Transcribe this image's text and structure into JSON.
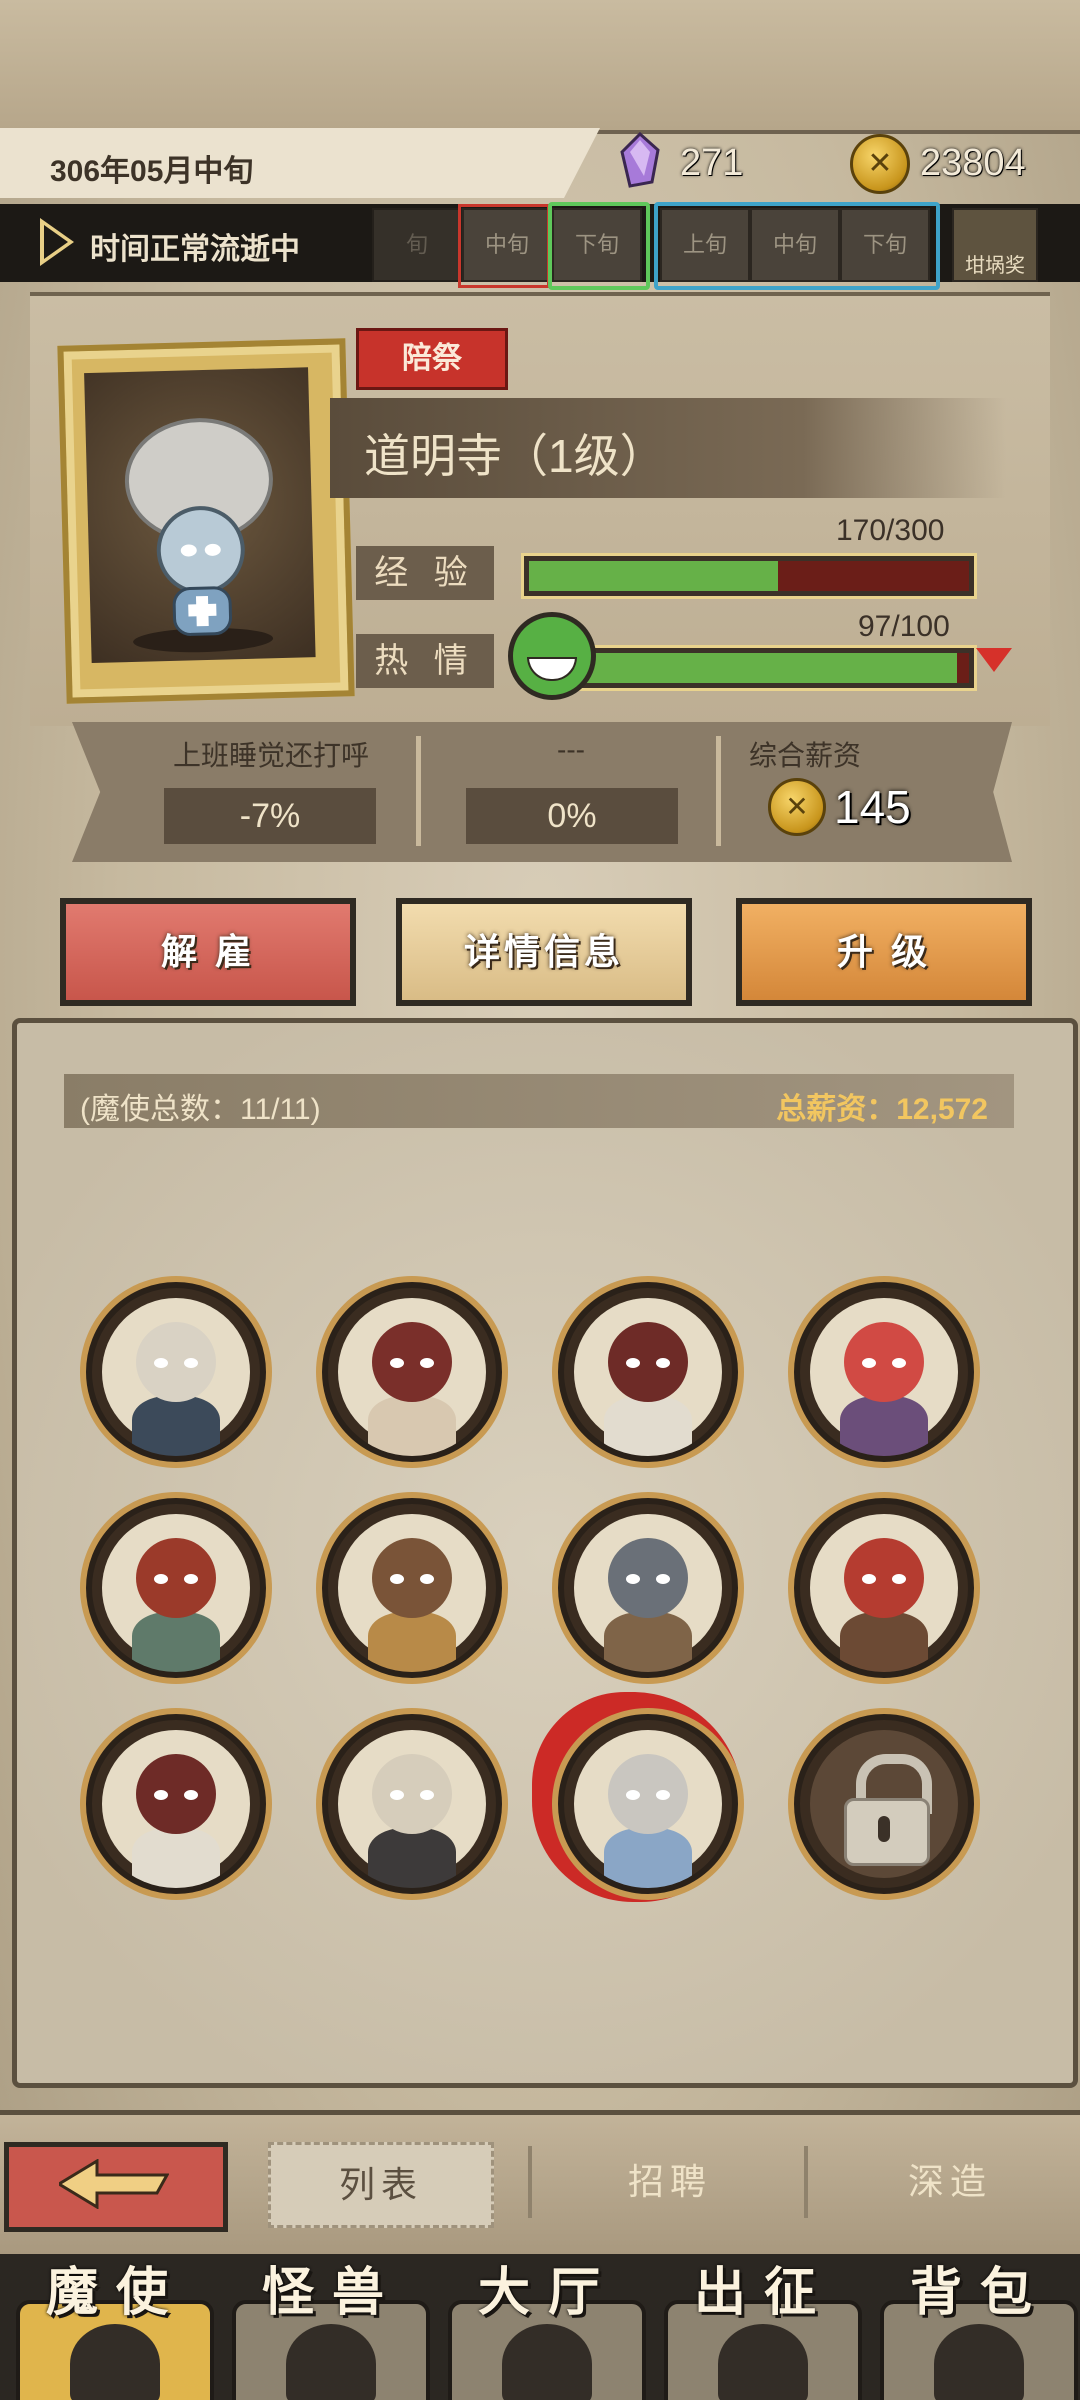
{
  "header": {
    "date": "306年05月中旬",
    "crystals": "271",
    "gold": "23804"
  },
  "timebar": {
    "status": "时间正常流逝中",
    "slots": [
      "旬",
      "中旬",
      "下旬",
      "上旬",
      "中旬",
      "下旬"
    ],
    "reward_label": "坩埚奖"
  },
  "profile": {
    "role_tag": "陪祭",
    "name": "道明寺（1级）",
    "exp_label": "经 验",
    "exp_value": "170/300",
    "exp_fraction": 0.567,
    "passion_label": "热 情",
    "passion_value": "97/100",
    "passion_fraction": 0.97
  },
  "traits": {
    "trait1_label": "上班睡觉还打呼",
    "trait1_value": "-7%",
    "trait2_label": "---",
    "trait2_value": "0%",
    "salary_label": "综合薪资",
    "salary_value": "145"
  },
  "actions": {
    "fire": "解 雇",
    "details": "详情信息",
    "upgrade": "升 级"
  },
  "list": {
    "count_text": "(魔使总数：11/11)",
    "total_salary": "总薪资：12,572",
    "avatars": [
      {
        "name": "avatar-1",
        "head": "#d9d2c4",
        "body": "#3c4a5a"
      },
      {
        "name": "avatar-2",
        "head": "#7a2f2a",
        "body": "#d8c8b0"
      },
      {
        "name": "avatar-3",
        "head": "#6e2b27",
        "body": "#e2dccf"
      },
      {
        "name": "avatar-4",
        "head": "#d14a44",
        "body": "#6b4e7a"
      },
      {
        "name": "avatar-5",
        "head": "#9b3a2a",
        "body": "#5f7a6a"
      },
      {
        "name": "avatar-6",
        "head": "#7a5438",
        "body": "#b88a48"
      },
      {
        "name": "avatar-7",
        "head": "#6a7078",
        "body": "#7f6448"
      },
      {
        "name": "avatar-8",
        "head": "#b53c30",
        "body": "#6c4a34"
      },
      {
        "name": "avatar-9",
        "head": "#6e2b27",
        "body": "#e2dccf"
      },
      {
        "name": "avatar-10",
        "head": "#d6cdbb",
        "body": "#3d3a3a"
      },
      {
        "name": "avatar-11",
        "head": "#c9c6c0",
        "body": "#8aa6c6"
      },
      {
        "name": "avatar-locked",
        "locked": true
      }
    ]
  },
  "subtabs": {
    "list": "列表",
    "recruit": "招聘",
    "deepen": "深造"
  },
  "mainnav": {
    "items": [
      "魔使",
      "怪兽",
      "大厅",
      "出征",
      "背包"
    ]
  },
  "colors": {
    "accent_red": "#c7332b",
    "bar_green": "#66b148",
    "gold_text": "#f2c660"
  }
}
